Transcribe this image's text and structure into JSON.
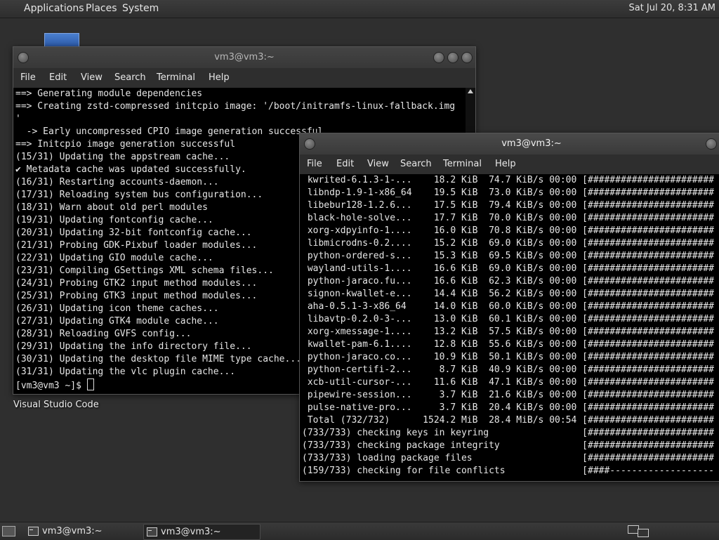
{
  "top_panel": {
    "menus": [
      "Applications",
      "Places",
      "System"
    ],
    "clock": "Sat Jul 20,  8:31 AM"
  },
  "desktop": {
    "icon_label": "Visual Studio Code"
  },
  "window_back": {
    "title": "vm3@vm3:~",
    "menu": [
      "File",
      "Edit",
      "View",
      "Search",
      "Terminal",
      "Help"
    ],
    "lines": [
      "==> Generating module dependencies",
      "==> Creating zstd-compressed initcpio image: '/boot/initramfs-linux-fallback.img",
      "'",
      "  -> Early uncompressed CPIO image generation successful",
      "==> Initcpio image generation successful",
      "(15/31) Updating the appstream cache...",
      "✔ Metadata cache was updated successfully.",
      "(16/31) Restarting accounts-daemon...",
      "(17/31) Reloading system bus configuration...",
      "(18/31) Warn about old perl modules",
      "(19/31) Updating fontconfig cache...",
      "(20/31) Updating 32-bit fontconfig cache...",
      "(21/31) Probing GDK-Pixbuf loader modules...",
      "(22/31) Updating GIO module cache...",
      "(23/31) Compiling GSettings XML schema files...",
      "(24/31) Probing GTK2 input method modules...",
      "(25/31) Probing GTK3 input method modules...",
      "(26/31) Updating icon theme caches...",
      "(27/31) Updating GTK4 module cache...",
      "(28/31) Reloading GVFS config...",
      "(29/31) Updating the info directory file...",
      "(30/31) Updating the desktop file MIME type cache...",
      "(31/31) Updating the vlc plugin cache..."
    ],
    "prompt": "[vm3@vm3 ~]$ "
  },
  "window_front": {
    "title": "vm3@vm3:~",
    "menu": [
      "File",
      "Edit",
      "View",
      "Search",
      "Terminal",
      "Help"
    ],
    "lines": [
      " kwrited-6.1.3-1-...    18.2 KiB  74.7 KiB/s 00:00 [#######################",
      " libndp-1.9-1-x86_64    19.5 KiB  73.0 KiB/s 00:00 [#######################",
      " libebur128-1.2.6...    17.5 KiB  79.4 KiB/s 00:00 [#######################",
      " black-hole-solve...    17.7 KiB  70.0 KiB/s 00:00 [#######################",
      " xorg-xdpyinfo-1....    16.0 KiB  70.8 KiB/s 00:00 [#######################",
      " libmicrodns-0.2....    15.2 KiB  69.0 KiB/s 00:00 [#######################",
      " python-ordered-s...    15.3 KiB  69.5 KiB/s 00:00 [#######################",
      " wayland-utils-1....    16.6 KiB  69.0 KiB/s 00:00 [#######################",
      " python-jaraco.fu...    16.6 KiB  62.3 KiB/s 00:00 [#######################",
      " signon-kwallet-e...    14.4 KiB  56.2 KiB/s 00:00 [#######################",
      " aha-0.5.1-3-x86_64     14.0 KiB  60.0 KiB/s 00:00 [#######################",
      " libavtp-0.2.0-3-...    13.0 KiB  60.1 KiB/s 00:00 [#######################",
      " xorg-xmessage-1....    13.2 KiB  57.5 KiB/s 00:00 [#######################",
      " kwallet-pam-6.1....    12.8 KiB  55.6 KiB/s 00:00 [#######################",
      " python-jaraco.co...    10.9 KiB  50.1 KiB/s 00:00 [#######################",
      " python-certifi-2...     8.7 KiB  40.9 KiB/s 00:00 [#######################",
      " xcb-util-cursor-...    11.6 KiB  47.1 KiB/s 00:00 [#######################",
      " pipewire-session...     3.7 KiB  21.6 KiB/s 00:00 [#######################",
      " pulse-native-pro...     3.7 KiB  20.4 KiB/s 00:00 [#######################",
      " Total (732/732)      1524.2 MiB  28.4 MiB/s 00:54 [#######################",
      "(733/733) checking keys in keyring                 [#######################",
      "(733/733) checking package integrity               [#######################",
      "(733/733) loading package files                    [#######################",
      "(159/733) checking for file conflicts              [####-------------------"
    ]
  },
  "bottom_panel": {
    "tasks": [
      "vm3@vm3:~",
      "vm3@vm3:~"
    ]
  }
}
